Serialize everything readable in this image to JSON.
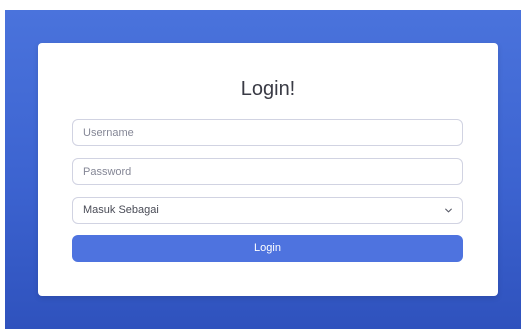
{
  "colors": {
    "background_gradient_top": "#4a73dc",
    "background_gradient_bottom": "#2f52bd",
    "card": "#ffffff",
    "button": "#4e73df",
    "input_border": "#d1d3e2"
  },
  "login_form": {
    "title": "Login!",
    "username_placeholder": "Username",
    "password_placeholder": "Password",
    "role_select_value": "Masuk Sebagai",
    "role_select_icon": "chevron-down-icon",
    "submit_label": "Login"
  }
}
